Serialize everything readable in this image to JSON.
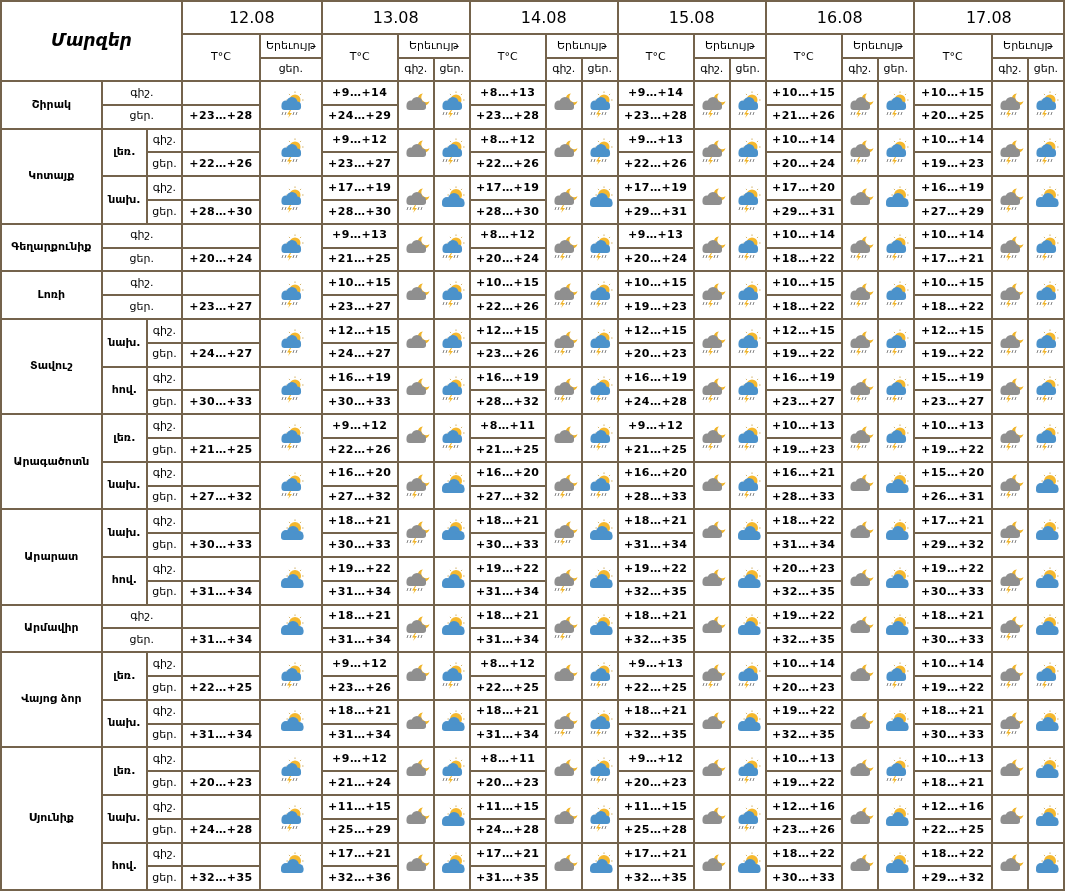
{
  "header": {
    "title": "Մարզեր",
    "days": [
      {
        "date": "12.08",
        "temp": "T°C",
        "phenomenon": "Երեւույթ",
        "sub": [
          "ցեր."
        ]
      },
      {
        "date": "13.08",
        "temp": "T°C",
        "phenomenon": "Երեւույթ",
        "sub": [
          "գիշ.",
          "ցեր."
        ]
      },
      {
        "date": "14.08",
        "temp": "T°C",
        "phenomenon": "Երեւույթ",
        "sub": [
          "գիշ.",
          "ցեր."
        ]
      },
      {
        "date": "15.08",
        "temp": "T°C",
        "phenomenon": "Երեւույթ",
        "sub": [
          "գիշ.",
          "ցեր."
        ]
      },
      {
        "date": "16.08",
        "temp": "T°C",
        "phenomenon": "Երեւույթ",
        "sub": [
          "գիշ.",
          "ցեր."
        ]
      },
      {
        "date": "17.08",
        "temp": "T°C",
        "phenomenon": "Երեւույթ",
        "sub": [
          "գիշ.",
          "ցեր."
        ]
      }
    ]
  },
  "regions": [
    {
      "name": "Շիրակ",
      "groups": [
        {
          "night_label": "գիշ.",
          "day_label": "ցեր.",
          "days": [
            {
              "day": "+23…+28",
              "icons": [
                {
                  "kind": "sun-storm"
                }
              ]
            },
            {
              "night": "+9…+14",
              "day": "+24…+29",
              "icons": [
                {
                  "kind": "moon-cloud"
                },
                {
                  "kind": "sun-storm"
                }
              ]
            },
            {
              "night": "+8…+13",
              "day": "+23…+28",
              "icons": [
                {
                  "kind": "moon-cloud"
                },
                {
                  "kind": "sun-storm"
                }
              ]
            },
            {
              "night": "+9…+14",
              "day": "+23…+28",
              "icons": [
                {
                  "kind": "moon-storm"
                },
                {
                  "kind": "sun-storm"
                }
              ]
            },
            {
              "night": "+10…+15",
              "day": "+21…+26",
              "icons": [
                {
                  "kind": "moon-storm"
                },
                {
                  "kind": "sun-storm"
                }
              ]
            },
            {
              "night": "+10…+15",
              "day": "+20…+25",
              "icons": [
                {
                  "kind": "moon-storm"
                },
                {
                  "kind": "sun-storm"
                }
              ]
            }
          ]
        }
      ]
    },
    {
      "name": "Կոտայք",
      "groups": [
        {
          "sub": "լեռ.",
          "night_label": "գիշ.",
          "day_label": "ցեր.",
          "days": [
            {
              "day": "+22…+26",
              "icons": [
                {
                  "kind": "sun-storm"
                }
              ]
            },
            {
              "night": "+9…+12",
              "day": "+23…+27",
              "icons": [
                {
                  "kind": "moon-cloud"
                },
                {
                  "kind": "sun-storm"
                }
              ]
            },
            {
              "night": "+8…+12",
              "day": "+22…+26",
              "icons": [
                {
                  "kind": "moon-cloud"
                },
                {
                  "kind": "sun-storm"
                }
              ]
            },
            {
              "night": "+9…+13",
              "day": "+22…+26",
              "icons": [
                {
                  "kind": "moon-storm"
                },
                {
                  "kind": "sun-storm"
                }
              ]
            },
            {
              "night": "+10…+14",
              "day": "+20…+24",
              "icons": [
                {
                  "kind": "moon-storm"
                },
                {
                  "kind": "sun-storm"
                }
              ]
            },
            {
              "night": "+10…+14",
              "day": "+19…+23",
              "icons": [
                {
                  "kind": "moon-storm"
                },
                {
                  "kind": "sun-storm"
                }
              ]
            }
          ]
        },
        {
          "sub": "նախ.",
          "night_label": "գիշ.",
          "day_label": "ցեր.",
          "days": [
            {
              "day": "+28…+30",
              "icons": [
                {
                  "kind": "sun-storm"
                }
              ]
            },
            {
              "night": "+17…+19",
              "day": "+28…+30",
              "icons": [
                {
                  "kind": "moon-storm"
                },
                {
                  "kind": "sun-cloud"
                }
              ]
            },
            {
              "night": "+17…+19",
              "day": "+28…+30",
              "icons": [
                {
                  "kind": "moon-storm"
                },
                {
                  "kind": "sun-cloud"
                }
              ]
            },
            {
              "night": "+17…+19",
              "day": "+29…+31",
              "icons": [
                {
                  "kind": "moon-cloud"
                },
                {
                  "kind": "sun-storm"
                }
              ]
            },
            {
              "night": "+17…+20",
              "day": "+29…+31",
              "icons": [
                {
                  "kind": "moon-cloud"
                },
                {
                  "kind": "sun-cloud"
                }
              ]
            },
            {
              "night": "+16…+19",
              "day": "+27…+29",
              "icons": [
                {
                  "kind": "moon-storm"
                },
                {
                  "kind": "sun-cloud"
                }
              ]
            }
          ]
        }
      ]
    },
    {
      "name": "Գեղարքունիք",
      "groups": [
        {
          "night_label": "գիշ.",
          "day_label": "ցեր.",
          "days": [
            {
              "day": "+20…+24",
              "icons": [
                {
                  "kind": "sun-storm"
                }
              ]
            },
            {
              "night": "+9…+13",
              "day": "+21…+25",
              "icons": [
                {
                  "kind": "moon-cloud"
                },
                {
                  "kind": "sun-storm"
                }
              ]
            },
            {
              "night": "+8…+12",
              "day": "+20…+24",
              "icons": [
                {
                  "kind": "moon-storm"
                },
                {
                  "kind": "sun-storm"
                }
              ]
            },
            {
              "night": "+9…+13",
              "day": "+20…+24",
              "icons": [
                {
                  "kind": "moon-storm"
                },
                {
                  "kind": "sun-storm"
                }
              ]
            },
            {
              "night": "+10…+14",
              "day": "+18…+22",
              "icons": [
                {
                  "kind": "moon-storm"
                },
                {
                  "kind": "sun-storm"
                }
              ]
            },
            {
              "night": "+10…+14",
              "day": "+17…+21",
              "icons": [
                {
                  "kind": "moon-storm"
                },
                {
                  "kind": "sun-storm"
                }
              ]
            }
          ]
        }
      ]
    },
    {
      "name": "Լոռի",
      "groups": [
        {
          "night_label": "գիշ.",
          "day_label": "ցեր.",
          "days": [
            {
              "day": "+23…+27",
              "icons": [
                {
                  "kind": "sun-storm"
                }
              ]
            },
            {
              "night": "+10…+15",
              "day": "+23…+27",
              "icons": [
                {
                  "kind": "moon-cloud"
                },
                {
                  "kind": "sun-storm"
                }
              ]
            },
            {
              "night": "+10…+15",
              "day": "+22…+26",
              "icons": [
                {
                  "kind": "moon-storm"
                },
                {
                  "kind": "sun-storm"
                }
              ]
            },
            {
              "night": "+10…+15",
              "day": "+19…+23",
              "icons": [
                {
                  "kind": "moon-storm"
                },
                {
                  "kind": "sun-storm"
                }
              ]
            },
            {
              "night": "+10…+15",
              "day": "+18…+22",
              "icons": [
                {
                  "kind": "moon-storm"
                },
                {
                  "kind": "sun-storm"
                }
              ]
            },
            {
              "night": "+10…+15",
              "day": "+18…+22",
              "icons": [
                {
                  "kind": "moon-storm"
                },
                {
                  "kind": "sun-storm"
                }
              ]
            }
          ]
        }
      ]
    },
    {
      "name": "Տավուշ",
      "groups": [
        {
          "sub": "նախ.",
          "night_label": "գիշ.",
          "day_label": "ցեր.",
          "days": [
            {
              "day": "+24…+27",
              "icons": [
                {
                  "kind": "sun-storm"
                }
              ]
            },
            {
              "night": "+12…+15",
              "day": "+24…+27",
              "icons": [
                {
                  "kind": "moon-cloud"
                },
                {
                  "kind": "sun-storm"
                }
              ]
            },
            {
              "night": "+12…+15",
              "day": "+23…+26",
              "icons": [
                {
                  "kind": "moon-storm"
                },
                {
                  "kind": "sun-storm"
                }
              ]
            },
            {
              "night": "+12…+15",
              "day": "+20…+23",
              "icons": [
                {
                  "kind": "moon-storm"
                },
                {
                  "kind": "sun-storm"
                }
              ]
            },
            {
              "night": "+12…+15",
              "day": "+19…+22",
              "icons": [
                {
                  "kind": "moon-storm"
                },
                {
                  "kind": "sun-storm"
                }
              ]
            },
            {
              "night": "+12…+15",
              "day": "+19…+22",
              "icons": [
                {
                  "kind": "moon-storm"
                },
                {
                  "kind": "sun-storm"
                }
              ]
            }
          ]
        },
        {
          "sub": "հով.",
          "night_label": "գիշ.",
          "day_label": "ցեր.",
          "days": [
            {
              "day": "+30…+33",
              "icons": [
                {
                  "kind": "sun-storm"
                }
              ]
            },
            {
              "night": "+16…+19",
              "day": "+30…+33",
              "icons": [
                {
                  "kind": "moon-cloud"
                },
                {
                  "kind": "sun-storm"
                }
              ]
            },
            {
              "night": "+16…+19",
              "day": "+28…+32",
              "icons": [
                {
                  "kind": "moon-storm"
                },
                {
                  "kind": "sun-storm"
                }
              ]
            },
            {
              "night": "+16…+19",
              "day": "+24…+28",
              "icons": [
                {
                  "kind": "moon-storm"
                },
                {
                  "kind": "sun-storm"
                }
              ]
            },
            {
              "night": "+16…+19",
              "day": "+23…+27",
              "icons": [
                {
                  "kind": "moon-storm"
                },
                {
                  "kind": "sun-storm"
                }
              ]
            },
            {
              "night": "+15…+19",
              "day": "+23…+27",
              "icons": [
                {
                  "kind": "moon-storm"
                },
                {
                  "kind": "sun-storm"
                }
              ]
            }
          ]
        }
      ]
    },
    {
      "name": "Արագածոտն",
      "groups": [
        {
          "sub": "լեռ.",
          "night_label": "գիշ.",
          "day_label": "ցեր.",
          "days": [
            {
              "day": "+21…+25",
              "icons": [
                {
                  "kind": "sun-storm"
                }
              ]
            },
            {
              "night": "+9…+12",
              "day": "+22…+26",
              "icons": [
                {
                  "kind": "moon-cloud"
                },
                {
                  "kind": "sun-storm"
                }
              ]
            },
            {
              "night": "+8…+11",
              "day": "+21…+25",
              "icons": [
                {
                  "kind": "moon-cloud"
                },
                {
                  "kind": "sun-storm"
                }
              ]
            },
            {
              "night": "+9…+12",
              "day": "+21…+25",
              "icons": [
                {
                  "kind": "moon-storm"
                },
                {
                  "kind": "sun-storm"
                }
              ]
            },
            {
              "night": "+10…+13",
              "day": "+19…+23",
              "icons": [
                {
                  "kind": "moon-storm"
                },
                {
                  "kind": "sun-storm"
                }
              ]
            },
            {
              "night": "+10…+13",
              "day": "+19…+22",
              "icons": [
                {
                  "kind": "moon-storm"
                },
                {
                  "kind": "sun-storm"
                }
              ]
            }
          ]
        },
        {
          "sub": "նախ.",
          "night_label": "գիշ.",
          "day_label": "ցեր.",
          "days": [
            {
              "day": "+27…+32",
              "icons": [
                {
                  "kind": "sun-storm"
                }
              ]
            },
            {
              "night": "+16…+20",
              "day": "+27…+32",
              "icons": [
                {
                  "kind": "moon-storm"
                },
                {
                  "kind": "sun-cloud"
                }
              ]
            },
            {
              "night": "+16…+20",
              "day": "+27…+32",
              "icons": [
                {
                  "kind": "moon-storm"
                },
                {
                  "kind": "sun-storm"
                }
              ]
            },
            {
              "night": "+16…+20",
              "day": "+28…+33",
              "icons": [
                {
                  "kind": "moon-cloud"
                },
                {
                  "kind": "sun-storm"
                }
              ]
            },
            {
              "night": "+16…+21",
              "day": "+28…+33",
              "icons": [
                {
                  "kind": "moon-cloud"
                },
                {
                  "kind": "sun-cloud"
                }
              ]
            },
            {
              "night": "+15…+20",
              "day": "+26…+31",
              "icons": [
                {
                  "kind": "moon-storm"
                },
                {
                  "kind": "sun-cloud"
                }
              ]
            }
          ]
        }
      ]
    },
    {
      "name": "Արարատ",
      "groups": [
        {
          "sub": "նախ.",
          "night_label": "գիշ.",
          "day_label": "ցեր.",
          "days": [
            {
              "day": "+30…+33",
              "icons": [
                {
                  "kind": "sun-cloud"
                }
              ]
            },
            {
              "night": "+18…+21",
              "day": "+30…+33",
              "icons": [
                {
                  "kind": "moon-storm"
                },
                {
                  "kind": "sun-cloud"
                }
              ]
            },
            {
              "night": "+18…+21",
              "day": "+30…+33",
              "icons": [
                {
                  "kind": "moon-storm"
                },
                {
                  "kind": "sun-cloud"
                }
              ]
            },
            {
              "night": "+18…+21",
              "day": "+31…+34",
              "icons": [
                {
                  "kind": "moon-cloud"
                },
                {
                  "kind": "sun-cloud"
                }
              ]
            },
            {
              "night": "+18…+22",
              "day": "+31…+34",
              "icons": [
                {
                  "kind": "moon-cloud"
                },
                {
                  "kind": "sun-cloud"
                }
              ]
            },
            {
              "night": "+17…+21",
              "day": "+29…+32",
              "icons": [
                {
                  "kind": "moon-storm"
                },
                {
                  "kind": "sun-cloud"
                }
              ]
            }
          ]
        },
        {
          "sub": "հով.",
          "night_label": "գիշ.",
          "day_label": "ցեր.",
          "days": [
            {
              "day": "+31…+34",
              "icons": [
                {
                  "kind": "sun-cloud"
                }
              ]
            },
            {
              "night": "+19…+22",
              "day": "+31…+34",
              "icons": [
                {
                  "kind": "moon-storm"
                },
                {
                  "kind": "sun-cloud"
                }
              ]
            },
            {
              "night": "+19…+22",
              "day": "+31…+34",
              "icons": [
                {
                  "kind": "moon-storm"
                },
                {
                  "kind": "sun-cloud"
                }
              ]
            },
            {
              "night": "+19…+22",
              "day": "+32…+35",
              "icons": [
                {
                  "kind": "moon-cloud"
                },
                {
                  "kind": "sun-cloud"
                }
              ]
            },
            {
              "night": "+20…+23",
              "day": "+32…+35",
              "icons": [
                {
                  "kind": "moon-cloud"
                },
                {
                  "kind": "sun-cloud"
                }
              ]
            },
            {
              "night": "+19…+22",
              "day": "+30…+33",
              "icons": [
                {
                  "kind": "moon-storm"
                },
                {
                  "kind": "sun-cloud"
                }
              ]
            }
          ]
        }
      ]
    },
    {
      "name": "Արմավիր",
      "groups": [
        {
          "night_label": "գիշ.",
          "day_label": "ցեր.",
          "days": [
            {
              "day": "+31…+34",
              "icons": [
                {
                  "kind": "sun-cloud"
                }
              ]
            },
            {
              "night": "+18…+21",
              "day": "+31…+34",
              "icons": [
                {
                  "kind": "moon-storm"
                },
                {
                  "kind": "sun-cloud"
                }
              ]
            },
            {
              "night": "+18…+21",
              "day": "+31…+34",
              "icons": [
                {
                  "kind": "moon-storm"
                },
                {
                  "kind": "sun-cloud"
                }
              ]
            },
            {
              "night": "+18…+21",
              "day": "+32…+35",
              "icons": [
                {
                  "kind": "moon-cloud"
                },
                {
                  "kind": "sun-cloud"
                }
              ]
            },
            {
              "night": "+19…+22",
              "day": "+32…+35",
              "icons": [
                {
                  "kind": "moon-cloud"
                },
                {
                  "kind": "sun-cloud"
                }
              ]
            },
            {
              "night": "+18…+21",
              "day": "+30…+33",
              "icons": [
                {
                  "kind": "moon-storm"
                },
                {
                  "kind": "sun-cloud"
                }
              ]
            }
          ]
        }
      ]
    },
    {
      "name": "Վայոց ձոր",
      "groups": [
        {
          "sub": "լեռ.",
          "night_label": "գիշ.",
          "day_label": "ցեր.",
          "days": [
            {
              "day": "+22…+25",
              "icons": [
                {
                  "kind": "sun-storm"
                }
              ]
            },
            {
              "night": "+9…+12",
              "day": "+23…+26",
              "icons": [
                {
                  "kind": "moon-cloud"
                },
                {
                  "kind": "sun-storm"
                }
              ]
            },
            {
              "night": "+8…+12",
              "day": "+22…+25",
              "icons": [
                {
                  "kind": "moon-cloud"
                },
                {
                  "kind": "sun-storm"
                }
              ]
            },
            {
              "night": "+9…+13",
              "day": "+22…+25",
              "icons": [
                {
                  "kind": "moon-storm"
                },
                {
                  "kind": "sun-storm"
                }
              ]
            },
            {
              "night": "+10…+14",
              "day": "+20…+23",
              "icons": [
                {
                  "kind": "moon-cloud"
                },
                {
                  "kind": "sun-storm"
                }
              ]
            },
            {
              "night": "+10…+14",
              "day": "+19…+22",
              "icons": [
                {
                  "kind": "moon-storm"
                },
                {
                  "kind": "sun-storm"
                }
              ]
            }
          ]
        },
        {
          "sub": "նախ.",
          "night_label": "գիշ.",
          "day_label": "ցեր.",
          "days": [
            {
              "day": "+31…+34",
              "icons": [
                {
                  "kind": "sun-cloud"
                }
              ]
            },
            {
              "night": "+18…+21",
              "day": "+31…+34",
              "icons": [
                {
                  "kind": "moon-cloud"
                },
                {
                  "kind": "sun-cloud"
                }
              ]
            },
            {
              "night": "+18…+21",
              "day": "+31…+34",
              "icons": [
                {
                  "kind": "moon-storm"
                },
                {
                  "kind": "sun-storm"
                }
              ]
            },
            {
              "night": "+18…+21",
              "day": "+32…+35",
              "icons": [
                {
                  "kind": "moon-cloud"
                },
                {
                  "kind": "sun-cloud"
                }
              ]
            },
            {
              "night": "+19…+22",
              "day": "+32…+35",
              "icons": [
                {
                  "kind": "moon-cloud"
                },
                {
                  "kind": "sun-cloud"
                }
              ]
            },
            {
              "night": "+18…+21",
              "day": "+30…+33",
              "icons": [
                {
                  "kind": "moon-storm"
                },
                {
                  "kind": "sun-cloud"
                }
              ]
            }
          ]
        }
      ]
    },
    {
      "name": "Սյունիք",
      "groups": [
        {
          "sub": "լեռ.",
          "night_label": "գիշ.",
          "day_label": "ցեր.",
          "days": [
            {
              "day": "+20…+23",
              "icons": [
                {
                  "kind": "sun-storm"
                }
              ]
            },
            {
              "night": "+9…+12",
              "day": "+21…+24",
              "icons": [
                {
                  "kind": "moon-cloud"
                },
                {
                  "kind": "sun-storm"
                }
              ]
            },
            {
              "night": "+8…+11",
              "day": "+20…+23",
              "icons": [
                {
                  "kind": "moon-cloud"
                },
                {
                  "kind": "sun-storm"
                }
              ]
            },
            {
              "night": "+9…+12",
              "day": "+20…+23",
              "icons": [
                {
                  "kind": "moon-cloud"
                },
                {
                  "kind": "sun-storm"
                }
              ]
            },
            {
              "night": "+10…+13",
              "day": "+19…+22",
              "icons": [
                {
                  "kind": "moon-cloud"
                },
                {
                  "kind": "sun-storm"
                }
              ]
            },
            {
              "night": "+10…+13",
              "day": "+18…+21",
              "icons": [
                {
                  "kind": "moon-cloud"
                },
                {
                  "kind": "sun-cloud"
                }
              ]
            }
          ]
        },
        {
          "sub": "նախ.",
          "night_label": "գիշ.",
          "day_label": "ցեր.",
          "days": [
            {
              "day": "+24…+28",
              "icons": [
                {
                  "kind": "sun-storm"
                }
              ]
            },
            {
              "night": "+11…+15",
              "day": "+25…+29",
              "icons": [
                {
                  "kind": "moon-cloud"
                },
                {
                  "kind": "sun-cloud"
                }
              ]
            },
            {
              "night": "+11…+15",
              "day": "+24…+28",
              "icons": [
                {
                  "kind": "moon-cloud"
                },
                {
                  "kind": "sun-storm"
                }
              ]
            },
            {
              "night": "+11…+15",
              "day": "+25…+28",
              "icons": [
                {
                  "kind": "moon-cloud"
                },
                {
                  "kind": "sun-storm"
                }
              ]
            },
            {
              "night": "+12…+16",
              "day": "+23…+26",
              "icons": [
                {
                  "kind": "moon-cloud"
                },
                {
                  "kind": "sun-cloud"
                }
              ]
            },
            {
              "night": "+12…+16",
              "day": "+22…+25",
              "icons": [
                {
                  "kind": "moon-cloud"
                },
                {
                  "kind": "sun-cloud"
                }
              ]
            }
          ]
        },
        {
          "sub": "հով.",
          "night_label": "գիշ.",
          "day_label": "ցեր.",
          "days": [
            {
              "day": "+32…+35",
              "icons": [
                {
                  "kind": "sun-cloud"
                }
              ]
            },
            {
              "night": "+17…+21",
              "day": "+32…+36",
              "icons": [
                {
                  "kind": "moon-cloud"
                },
                {
                  "kind": "sun-cloud"
                }
              ]
            },
            {
              "night": "+17…+21",
              "day": "+31…+35",
              "icons": [
                {
                  "kind": "moon-cloud"
                },
                {
                  "kind": "sun-cloud"
                }
              ]
            },
            {
              "night": "+17…+21",
              "day": "+32…+35",
              "icons": [
                {
                  "kind": "moon-cloud"
                },
                {
                  "kind": "sun-cloud"
                }
              ]
            },
            {
              "night": "+18…+22",
              "day": "+30…+33",
              "icons": [
                {
                  "kind": "moon-cloud"
                },
                {
                  "kind": "sun-cloud"
                }
              ]
            },
            {
              "night": "+18…+22",
              "day": "+29…+32",
              "icons": [
                {
                  "kind": "moon-cloud"
                },
                {
                  "kind": "sun-cloud"
                }
              ]
            }
          ]
        }
      ]
    }
  ]
}
